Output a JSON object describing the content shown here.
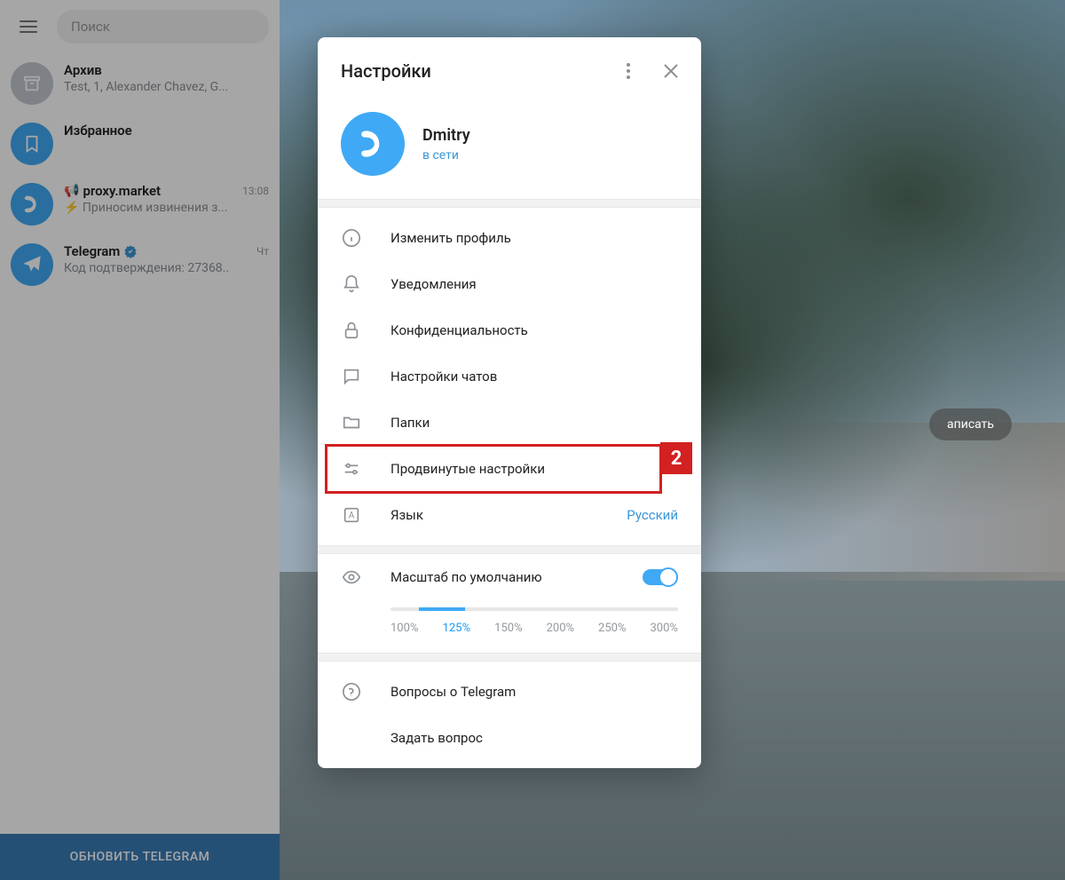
{
  "search": {
    "placeholder": "Поиск"
  },
  "chats": [
    {
      "title": "Архив",
      "preview": "Test, 1, Alexander Chavez, G...",
      "avatar_bg": "#c2c7cc",
      "time": ""
    },
    {
      "title": "Избранное",
      "preview": "",
      "avatar_bg": "#3fa9f5",
      "time": ""
    },
    {
      "title": "proxy.market",
      "preview": "⚡ Приносим извинения з...",
      "avatar_bg": "#3fa9f5",
      "time": "13:08",
      "megaphone": true
    },
    {
      "title": "Telegram",
      "preview": "Код подтверждения: 27368..",
      "avatar_bg": "#3fa9f5",
      "time": "Чт",
      "verified": true
    }
  ],
  "update_button": "ОБНОВИТЬ TELEGRAM",
  "action_pill": "аписать",
  "modal": {
    "title": "Настройки",
    "profile": {
      "name": "Dmitry",
      "status": "в сети"
    },
    "items": [
      {
        "label": "Изменить профиль",
        "icon": "info"
      },
      {
        "label": "Уведомления",
        "icon": "bell"
      },
      {
        "label": "Конфиденциальность",
        "icon": "lock"
      },
      {
        "label": "Настройки чатов",
        "icon": "chat"
      },
      {
        "label": "Папки",
        "icon": "folder"
      },
      {
        "label": "Продвинутые настройки",
        "icon": "sliders",
        "highlight": "2"
      },
      {
        "label": "Язык",
        "icon": "language",
        "value": "Русский"
      }
    ],
    "scale": {
      "label": "Масштаб по умолчанию",
      "options": [
        "100%",
        "125%",
        "150%",
        "200%",
        "250%",
        "300%"
      ],
      "active_index": 1
    },
    "help": [
      {
        "label": "Вопросы о Telegram",
        "icon": "help"
      },
      {
        "label": "Задать вопрос",
        "icon": ""
      }
    ]
  }
}
